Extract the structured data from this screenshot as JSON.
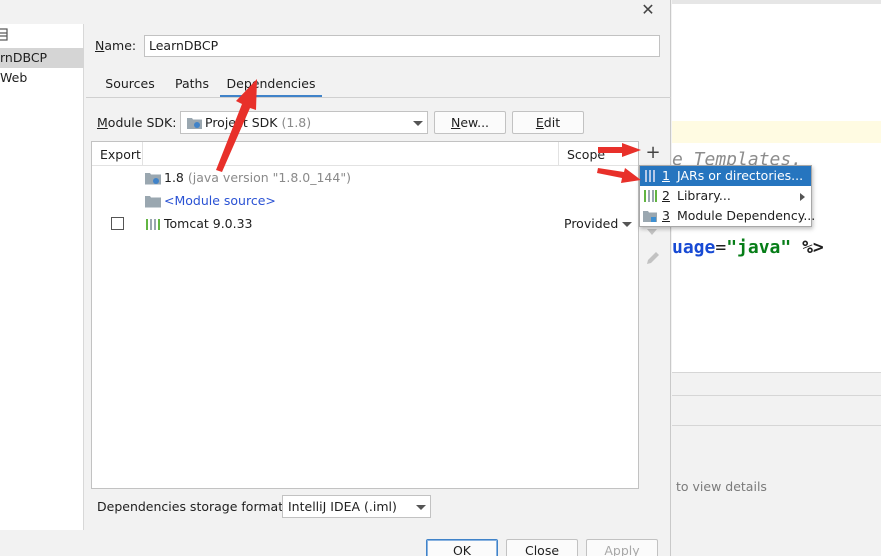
{
  "dialog": {
    "tree": {
      "items": [
        {
          "label": "rnDBCP",
          "selected": true
        },
        {
          "label": "Web",
          "selected": false
        }
      ]
    },
    "name_label_prefix": "N",
    "name_label_rest": "ame:",
    "name_value": "LearnDBCP",
    "tabs": [
      {
        "label": "Sources",
        "active": false
      },
      {
        "label": "Paths",
        "active": false
      },
      {
        "label": "Dependencies",
        "active": true
      }
    ],
    "module_sdk_label_prefix": "M",
    "module_sdk_label_rest": "odule SDK:",
    "module_sdk_value": "Project SDK",
    "module_sdk_version": "(1.8)",
    "new_button_prefix": "N",
    "new_button_rest": "ew...",
    "edit_button_prefix": "E",
    "edit_button_rest": "dit",
    "table": {
      "col_export": "Export",
      "col_scope": "Scope",
      "rows": [
        {
          "name": "1.8",
          "detail": "(java version \"1.8.0_144\")",
          "scope": "",
          "checkbox": false
        },
        {
          "name": "<Module source>",
          "detail": "",
          "scope": "",
          "checkbox": false
        },
        {
          "name": "Tomcat 9.0.33",
          "detail": "",
          "scope": "Provided",
          "checkbox": true,
          "checked": false
        }
      ]
    },
    "popup_menu": [
      {
        "num": "1",
        "label": "JARs or directories...",
        "selected": true,
        "submenu": false
      },
      {
        "num": "2",
        "label": "Library...",
        "selected": false,
        "submenu": true
      },
      {
        "num": "3",
        "label": "Module Dependency...",
        "selected": false,
        "submenu": false
      }
    ],
    "storage_format_label": "Dependencies storage format:",
    "storage_format_value": "IntelliJ IDEA (.iml)",
    "footer": {
      "ok": "OK",
      "close": "Close",
      "apply": "Apply"
    }
  },
  "editor": {
    "code_line1": "e Templates.",
    "code_line2_attr": "uage",
    "code_line2_eq": "=",
    "code_line2_str": "\"java\"",
    "code_line2_end": " %>",
    "hint": "to view details"
  },
  "colors": {
    "accent": "#4083c9",
    "menu_selection": "#2675bf",
    "annotation_arrow": "#e8302a",
    "link": "#2a52d4"
  }
}
